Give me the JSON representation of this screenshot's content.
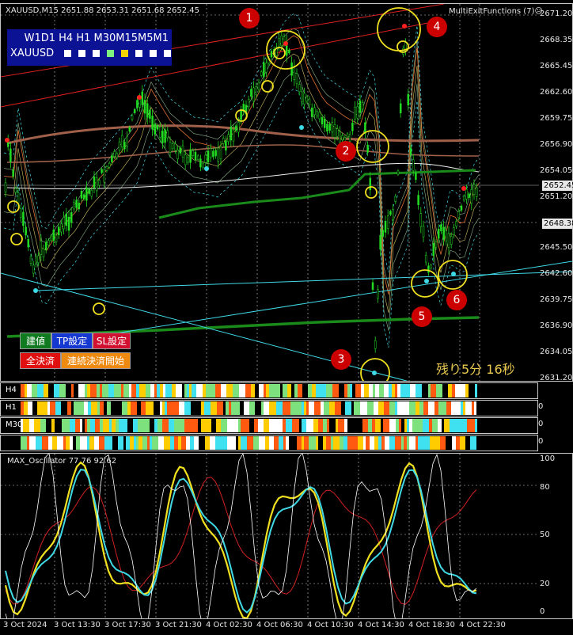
{
  "chart": {
    "header": "XAUUSD,M15  2651.88 2653.31 2651.68 2652.45",
    "indicator_name": "MultiExitFunctions (7)☹",
    "timeframes": "W1D1 H4 H1 M30M15M5M1",
    "symbol": "XAUUSD",
    "countdown": "残り5分 16秒",
    "current_price": "2652.45",
    "second_price": "2648.38"
  },
  "buttons": {
    "entry": "建値",
    "tp": "TP設定",
    "sl": "SL設定",
    "close_all": "全決済",
    "continuous": "連続決済開始"
  },
  "markers": [
    "1",
    "2",
    "3",
    "4",
    "5",
    "6"
  ],
  "price_axis": [
    "2671.20",
    "2668.35",
    "2665.45",
    "2662.60",
    "2659.75",
    "2656.90",
    "2654.05",
    "2651.20",
    "2648.38",
    "2645.50",
    "2642.60",
    "2639.75",
    "2636.90",
    "2634.05",
    "2631.20"
  ],
  "strips": {
    "h4": "H4",
    "h1": "H1",
    "m30": "M30",
    "m15_value": "0",
    "h1_value": "0",
    "m30_value": "0"
  },
  "oscillator": {
    "title": "MAX_Oscillator 77 76 92 62",
    "axis": [
      "100",
      "80",
      "50",
      "20",
      "0"
    ]
  },
  "time_axis": [
    "3 Oct 2024",
    "3 Oct 13:30",
    "3 Oct 17:30",
    "3 Oct 21:30",
    "4 Oct 02:30",
    "4 Oct 06:30",
    "4 Oct 10:30",
    "4 Oct 14:30",
    "4 Oct 18:30",
    "4 Oct 22:30"
  ],
  "colors": {
    "candle": "#22dd22",
    "marker": "#cc0000",
    "panel": "#0c1294",
    "cyan": "#3fd9e6",
    "yellow": "#f0e020"
  }
}
